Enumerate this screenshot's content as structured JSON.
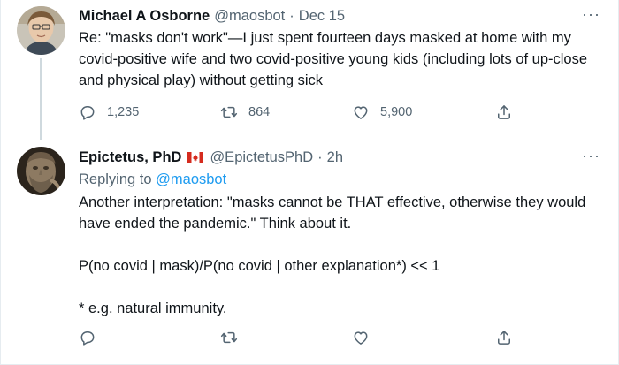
{
  "tweets": [
    {
      "name": "Michael A Osborne",
      "handle": "@maosbot",
      "separator": "·",
      "time": "Dec 15",
      "more": "···",
      "text": "Re: \"masks don't work\"—I just spent fourteen days masked at home with my covid-positive wife and two covid-positive young kids (including lots of up-close and physical play) without getting sick",
      "replies": "1,235",
      "retweets": "864",
      "likes": "5,900"
    },
    {
      "name": "Epictetus, PhD",
      "flag": "canada-flag-icon",
      "handle": "@EpictetusPhD",
      "separator": "·",
      "time": "2h",
      "more": "···",
      "replying_prefix": "Replying to",
      "replying_to": "@maosbot",
      "lines": [
        "Another interpretation: \"masks cannot be THAT effective, otherwise they would have ended the pandemic.\" Think about it.",
        "P(no covid | mask)/P(no covid | other explanation*)  << 1",
        "* e.g. natural immunity."
      ]
    }
  ],
  "icons": {
    "reply": "reply-icon",
    "retweet": "retweet-icon",
    "like": "heart-icon",
    "share": "share-icon"
  },
  "colors": {
    "text": "#0f1419",
    "secondary": "#536471",
    "link": "#1d9bf0",
    "thread_line": "#cfd9de",
    "divider": "#e6ecf0"
  }
}
